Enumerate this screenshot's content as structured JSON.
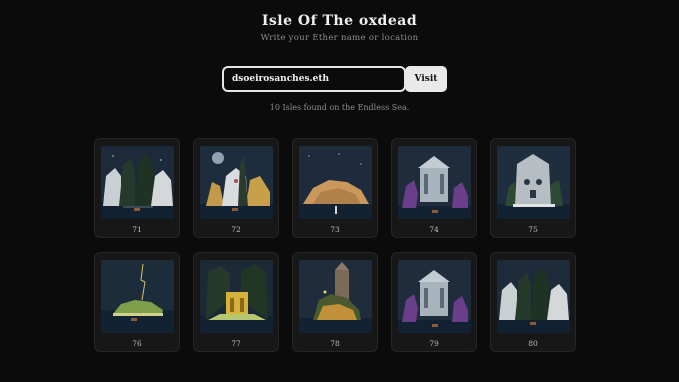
{
  "header": {
    "title": "Isle Of The oxdead",
    "subtitle": "Write your Ether name or location"
  },
  "search": {
    "value": "dsoeirosanches.eth",
    "button_label": "Visit"
  },
  "status_text": "10 Isles found on the Endless Sea.",
  "isles": [
    {
      "label": "71",
      "scene": "white-cliffs-trees"
    },
    {
      "label": "72",
      "scene": "face-rock-golden-cliffs"
    },
    {
      "label": "73",
      "scene": "sand-mound"
    },
    {
      "label": "74",
      "scene": "ruined-temple-purple-trees"
    },
    {
      "label": "75",
      "scene": "skull-castle"
    },
    {
      "label": "76",
      "scene": "lightning-green-isle"
    },
    {
      "label": "77",
      "scene": "golden-shrine-forest"
    },
    {
      "label": "78",
      "scene": "tower-ruins"
    },
    {
      "label": "79",
      "scene": "ruined-temple-purple-trees"
    },
    {
      "label": "80",
      "scene": "white-cliffs-trees"
    }
  ]
}
